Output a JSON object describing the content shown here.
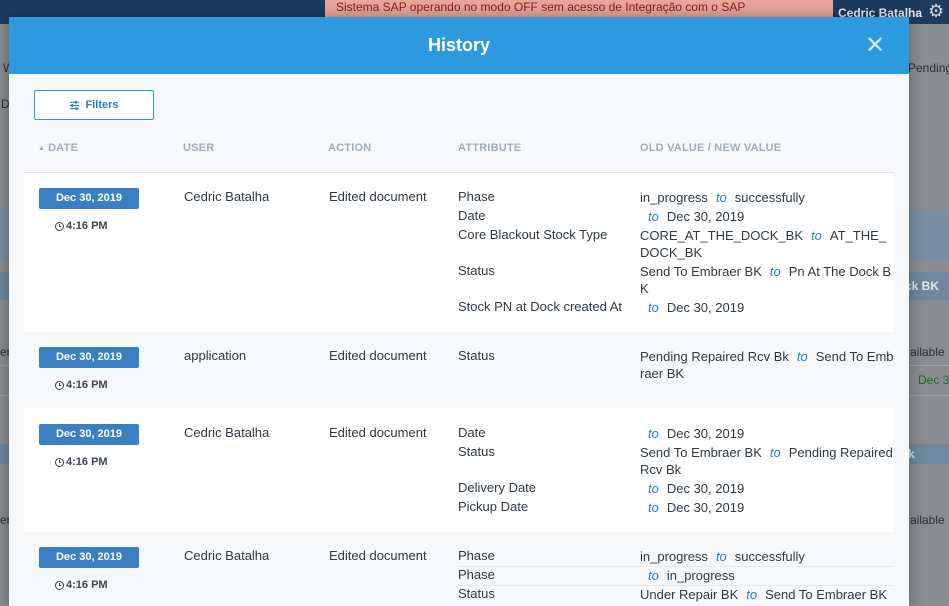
{
  "background": {
    "banner": "Sistema SAP operando no modo OFF sem acesso de Integração com o SAP",
    "user_name": "Cedric Batalha",
    "gear_icon": "gear-icon",
    "side_texts": {
      "left_w": "W",
      "left_d": "D",
      "left_er1": "er",
      "left_er2": "er",
      "right_pending": "Pending",
      "right_dock_bk": "ck BK",
      "right_available1": "ailable",
      "right_dec": "Dec 3",
      "right_k": "k",
      "right_available2": "ailable"
    }
  },
  "modal": {
    "title": "History",
    "close_icon": "close-icon",
    "filters_label": "Filters",
    "columns": {
      "date": "DATE",
      "user": "USER",
      "action": "ACTION",
      "attribute": "ATTRIBUTE",
      "values": "OLD VALUE / NEW VALUE"
    },
    "to_word": "to",
    "entries": [
      {
        "date": "Dec 30, 2019",
        "time": "4:16 PM",
        "user": "Cedric Batalha",
        "action": "Edited document",
        "changes": [
          {
            "attribute": "Phase",
            "old": "in_progress",
            "new": "successfully"
          },
          {
            "attribute": "Date",
            "old": "",
            "new": "Dec 30, 2019"
          },
          {
            "attribute": "Core Blackout Stock Type",
            "old": "CORE_AT_THE_DOCK_BK",
            "new": "AT_THE_DOCK_BK"
          },
          {
            "attribute": "Status",
            "old": "Send To Embraer BK",
            "new": "Pn At The Dock BK"
          },
          {
            "attribute": "Stock PN at Dock created At",
            "old": "",
            "new": "Dec 30, 2019"
          }
        ]
      },
      {
        "date": "Dec 30, 2019",
        "time": "4:16 PM",
        "user": "application",
        "action": "Edited document",
        "changes": [
          {
            "attribute": "Status",
            "old": "Pending Repaired Rcv Bk",
            "new": "Send To Embraer BK"
          }
        ]
      },
      {
        "date": "Dec 30, 2019",
        "time": "4:16 PM",
        "user": "Cedric Batalha",
        "action": "Edited document",
        "changes": [
          {
            "attribute": "Date",
            "old": "",
            "new": "Dec 30, 2019"
          },
          {
            "attribute": "Status",
            "old": "Send To Embraer BK",
            "new": "Pending Repaired Rcv Bk"
          },
          {
            "attribute": "Delivery Date",
            "old": "",
            "new": "Dec 30, 2019"
          },
          {
            "attribute": "Pickup Date",
            "old": "",
            "new": "Dec 30, 2019"
          }
        ]
      },
      {
        "date": "Dec 30, 2019",
        "time": "4:16 PM",
        "user": "Cedric Batalha",
        "action": "Edited document",
        "changes": [
          {
            "attribute": "Phase",
            "old": "in_progress",
            "new": "successfully"
          },
          {
            "attribute": "Phase",
            "old": "",
            "new": "in_progress"
          },
          {
            "attribute": "Status",
            "old": "Under Repair BK",
            "new": "Send To Embraer BK"
          }
        ]
      }
    ]
  }
}
